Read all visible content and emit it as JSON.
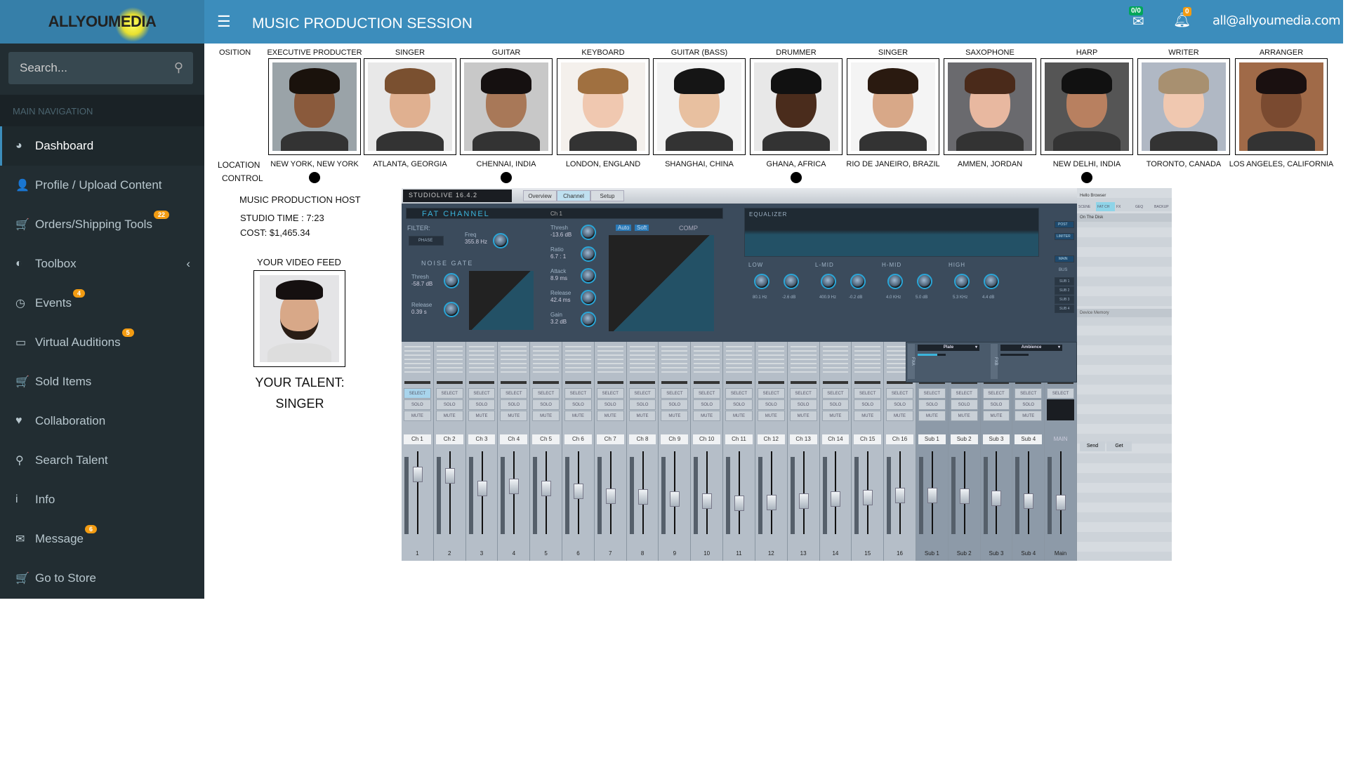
{
  "logo": "ALLYOUMEDIA",
  "header": {
    "title": "MUSIC PRODUCTION SESSION",
    "mail_badge": "0/0",
    "bell_badge": "0",
    "user_email": "all@allyoumedia.com"
  },
  "sidebar": {
    "search_placeholder": "Search...",
    "section": "MAIN NAVIGATION",
    "items": [
      {
        "label": "Dashboard",
        "icon": "dashboard-icon",
        "glyph": "◕",
        "active": true
      },
      {
        "label": "Profile / Upload Content",
        "icon": "user-icon",
        "glyph": "👤"
      },
      {
        "label": "Orders/Shipping Tools",
        "icon": "cart-icon",
        "glyph": "🛒",
        "badge": "22"
      },
      {
        "label": "Toolbox",
        "icon": "half-circle-icon",
        "glyph": "◐",
        "chevron": "‹"
      },
      {
        "label": "Events",
        "icon": "clock-icon",
        "glyph": "◷",
        "badge": "4"
      },
      {
        "label": "Virtual Auditions",
        "icon": "monitor-icon",
        "glyph": "▭",
        "badge": "5"
      },
      {
        "label": "Sold Items",
        "icon": "cart-icon",
        "glyph": "🛒"
      },
      {
        "label": "Collaboration",
        "icon": "heartbeat-icon",
        "glyph": "♥"
      },
      {
        "label": "Search Talent",
        "icon": "search-icon",
        "glyph": "⚲"
      },
      {
        "label": "Info",
        "icon": "info-icon",
        "glyph": "i"
      },
      {
        "label": "Message",
        "icon": "envelope-icon",
        "glyph": "✉",
        "badge": "6"
      },
      {
        "label": "Go to Store",
        "icon": "cart-icon",
        "glyph": "🛒"
      }
    ]
  },
  "grid": {
    "position_label": "OSITION",
    "location_label": "LOCATION",
    "control_label": "CONTROL",
    "talents": [
      {
        "role": "EXECUTIVE PRODUCTER",
        "location": "NEW YORK, NEW YORK",
        "control": true,
        "skin": "#8a5a3c",
        "hair": "#1a120c",
        "bg": "#9aa3a8"
      },
      {
        "role": "SINGER",
        "location": "ATLANTA, GEORGIA",
        "control": false,
        "skin": "#e0b090",
        "hair": "#7a5030",
        "bg": "#e8e8e8"
      },
      {
        "role": "GUITAR",
        "location": "CHENNAI, INDIA",
        "control": true,
        "skin": "#a87858",
        "hair": "#151010",
        "bg": "#c8c8c8"
      },
      {
        "role": "KEYBOARD",
        "location": "LONDON, ENGLAND",
        "control": false,
        "skin": "#f0c8b0",
        "hair": "#a07040",
        "bg": "#f4f0ec"
      },
      {
        "role": "GUITAR (BASS)",
        "location": "SHANGHAI, CHINA",
        "control": false,
        "skin": "#e8c0a0",
        "hair": "#151515",
        "bg": "#f2f2f2"
      },
      {
        "role": "DRUMMER",
        "location": "GHANA, AFRICA",
        "control": true,
        "skin": "#4a2c1c",
        "hair": "#111",
        "bg": "#e8e8e8"
      },
      {
        "role": "SINGER",
        "location": "RIO DE JANEIRO, BRAZIL",
        "control": false,
        "skin": "#d8a888",
        "hair": "#2a1a10",
        "bg": "#f4f4f4"
      },
      {
        "role": "SAXOPHONE",
        "location": "AMMEN, JORDAN",
        "control": false,
        "skin": "#e8b8a0",
        "hair": "#4a2a1a",
        "bg": "#6a6a6e"
      },
      {
        "role": "HARP",
        "location": "NEW DELHI, INDIA",
        "control": true,
        "skin": "#b88060",
        "hair": "#111",
        "bg": "#555"
      },
      {
        "role": "WRITER",
        "location": "TORONTO, CANADA",
        "control": false,
        "skin": "#f0c8b0",
        "hair": "#a89070",
        "bg": "#b0b8c4"
      },
      {
        "role": "ARRANGER",
        "location": "LOS ANGELES, CALIFORNIA",
        "control": false,
        "skin": "#7a4a30",
        "hair": "#1a1010",
        "bg": "#a06a48"
      }
    ]
  },
  "session": {
    "host": "MUSIC PRODUCTION HOST",
    "studio_time": "STUDIO TIME : 7:23",
    "cost": "COST: $1,465.34",
    "video_feed": "YOUR VIDEO FEED",
    "talent_label": "YOUR TALENT:",
    "talent_value": "SINGER"
  },
  "mixer": {
    "product": "STUDIOLIVE 16.4.2",
    "tabs": [
      "Overview",
      "Channel",
      "Setup"
    ],
    "fat_channel": "FAT CHANNEL",
    "channel": "Ch 1",
    "filter": "FILTER:",
    "phase": "PHASE",
    "freq": "Freq",
    "freq_val": "355.8 Hz",
    "noise_gate": "NOISE GATE",
    "thresh": "Thresh",
    "gate_thresh": "-58.7 dB",
    "release": "Release",
    "gate_release": "0.39 s",
    "comp": "COMP",
    "comp_params": [
      [
        "Thresh",
        "-13.6 dB"
      ],
      [
        "Ratio",
        "6.7 : 1"
      ],
      [
        "Attack",
        "8.9 ms"
      ],
      [
        "Release",
        "42.4 ms"
      ],
      [
        "Gain",
        "3.2 dB"
      ]
    ],
    "auto": "Auto",
    "soft": "Soft",
    "equalizer": "EQUALIZER",
    "bands": [
      {
        "name": "LOW",
        "freq": "80.1 Hz",
        "gain": "-2.6 dB"
      },
      {
        "name": "L-MID",
        "freq": "400.9 Hz",
        "gain": "-0.2 dB"
      },
      {
        "name": "H-MID",
        "freq": "4.0 KHz",
        "gain": "5.0 dB"
      },
      {
        "name": "HIGH",
        "freq": "5.3 KHz",
        "gain": "4.4 dB"
      }
    ],
    "post": "POST",
    "limiter": "LIMITER",
    "main": "MAIN",
    "bus": "BUS",
    "subs": [
      "SUB 1",
      "SUB 2",
      "SUB 3",
      "SUB 4"
    ],
    "browser": {
      "title": "Hello Browser",
      "tabs": [
        "SCENE",
        "FAT CH",
        "FX",
        "GEQ",
        "BACKUP"
      ],
      "on_disk": "On The Disk",
      "device_memory": "Device Memory",
      "send": "Send",
      "get": "Get"
    },
    "fx": [
      "Plate",
      "Ambience"
    ],
    "select": "SELECT",
    "solo": "SOLO",
    "mute": "MUTE",
    "strips": [
      {
        "label": "Ch 1",
        "num": "1",
        "level": 0.72
      },
      {
        "label": "Ch 2",
        "num": "2",
        "level": 0.7
      },
      {
        "label": "Ch 3",
        "num": "3",
        "level": 0.55
      },
      {
        "label": "Ch 4",
        "num": "4",
        "level": 0.58
      },
      {
        "label": "Ch 5",
        "num": "5",
        "level": 0.55
      },
      {
        "label": "Ch 6",
        "num": "6",
        "level": 0.52
      },
      {
        "label": "Ch 7",
        "num": "7",
        "level": 0.46
      },
      {
        "label": "Ch 8",
        "num": "8",
        "level": 0.45
      },
      {
        "label": "Ch 9",
        "num": "9",
        "level": 0.42
      },
      {
        "label": "Ch 10",
        "num": "10",
        "level": 0.4
      },
      {
        "label": "Ch 11",
        "num": "11",
        "level": 0.37
      },
      {
        "label": "Ch 12",
        "num": "12",
        "level": 0.38
      },
      {
        "label": "Ch 13",
        "num": "13",
        "level": 0.4
      },
      {
        "label": "Ch 14",
        "num": "14",
        "level": 0.42
      },
      {
        "label": "Ch 15",
        "num": "15",
        "level": 0.44
      },
      {
        "label": "Ch 16",
        "num": "16",
        "level": 0.47
      },
      {
        "label": "Sub 1",
        "num": "Sub 1",
        "level": 0.47,
        "sub": true
      },
      {
        "label": "Sub 2",
        "num": "Sub 2",
        "level": 0.46,
        "sub": true
      },
      {
        "label": "Sub 3",
        "num": "Sub 3",
        "level": 0.43,
        "sub": true
      },
      {
        "label": "Sub 4",
        "num": "Sub 4",
        "level": 0.4,
        "sub": true
      },
      {
        "label": "MAIN",
        "num": "Main",
        "level": 0.38,
        "sub": true,
        "main": true
      }
    ]
  }
}
